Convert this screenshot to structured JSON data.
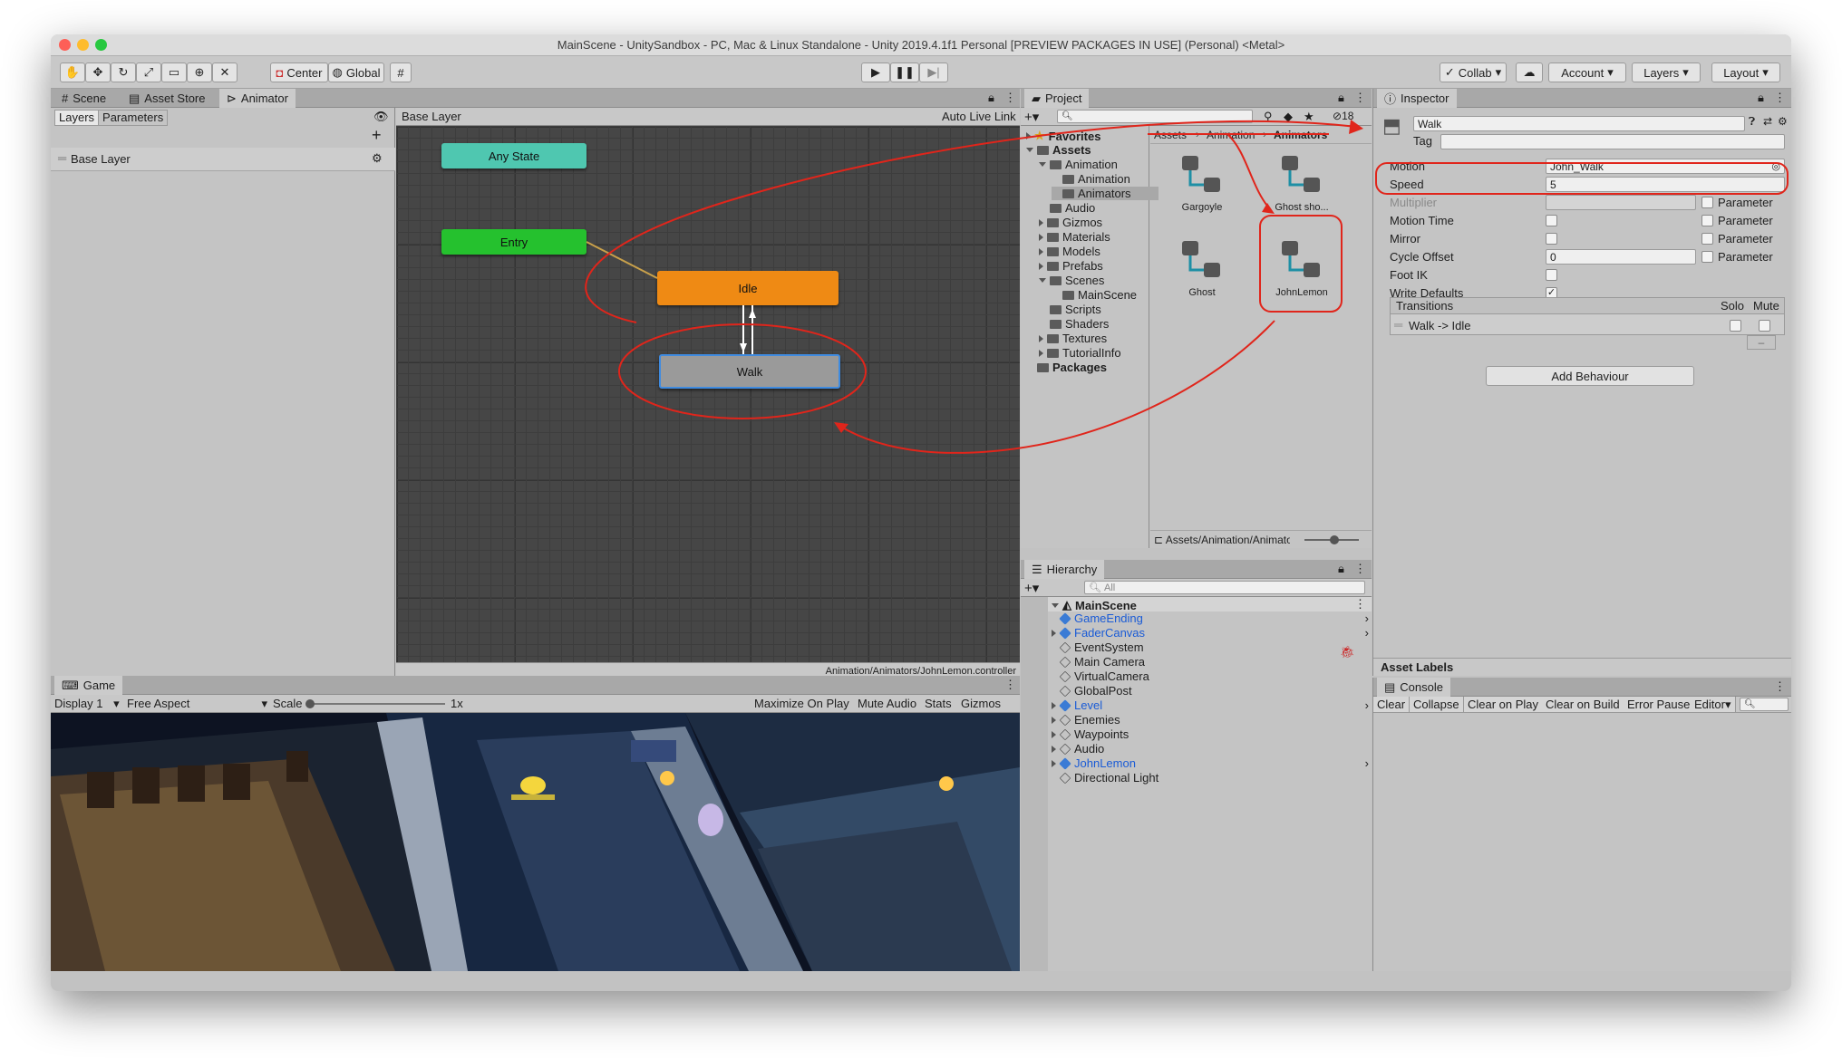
{
  "window": {
    "title": "MainScene - UnitySandbox - PC, Mac & Linux Standalone - Unity 2019.4.1f1 Personal [PREVIEW PACKAGES IN USE] (Personal) <Metal>"
  },
  "toolbar": {
    "center_label": "Center",
    "global_label": "Global",
    "collab_label": "Collab",
    "account_label": "Account",
    "layers_label": "Layers",
    "layout_label": "Layout"
  },
  "left_tabs": [
    "Scene",
    "Asset Store",
    "Animator"
  ],
  "animator": {
    "subtabs": [
      "Layers",
      "Parameters"
    ],
    "layer_name": "Base Layer",
    "breadcrumb": "Base Layer",
    "auto_live_link": "Auto Live Link",
    "footer_path": "Animation/Animators/JohnLemon.controller",
    "states": {
      "any_state": "Any State",
      "entry": "Entry",
      "idle": "Idle",
      "walk": "Walk"
    }
  },
  "game": {
    "tab": "Game",
    "display": "Display 1",
    "aspect": "Free Aspect",
    "scale_label": "Scale",
    "scale_value": "1x",
    "buttons": [
      "Maximize On Play",
      "Mute Audio",
      "Stats",
      "Gizmos"
    ]
  },
  "project": {
    "tab": "Project",
    "favorites": "Favorites",
    "tree": [
      {
        "label": "Assets",
        "depth": 0,
        "expanded": true,
        "bold": true
      },
      {
        "label": "Animation",
        "depth": 1,
        "expanded": true
      },
      {
        "label": "Animation",
        "depth": 2
      },
      {
        "label": "Animators",
        "depth": 2,
        "selected": true
      },
      {
        "label": "Audio",
        "depth": 1
      },
      {
        "label": "Gizmos",
        "depth": 1,
        "collapsed": true
      },
      {
        "label": "Materials",
        "depth": 1,
        "collapsed": true
      },
      {
        "label": "Models",
        "depth": 1,
        "collapsed": true
      },
      {
        "label": "Prefabs",
        "depth": 1,
        "collapsed": true
      },
      {
        "label": "Scenes",
        "depth": 1,
        "expanded": true
      },
      {
        "label": "MainScene",
        "depth": 2
      },
      {
        "label": "Scripts",
        "depth": 1
      },
      {
        "label": "Shaders",
        "depth": 1
      },
      {
        "label": "Textures",
        "depth": 1,
        "collapsed": true
      },
      {
        "label": "TutorialInfo",
        "depth": 1,
        "collapsed": true
      },
      {
        "label": "Packages",
        "depth": 0,
        "bold": true
      }
    ],
    "breadcrumb": [
      "Assets",
      "Animation",
      "Animators"
    ],
    "assets": [
      "Gargoyle",
      "Ghost sho...",
      "Ghost",
      "JohnLemon"
    ],
    "footer_path": "Assets/Animation/Animator",
    "hidden_count": "18"
  },
  "hierarchy": {
    "tab": "Hierarchy",
    "search_placeholder": "All",
    "scene": "MainScene",
    "items": [
      {
        "label": "GameEnding",
        "prefab": true
      },
      {
        "label": "FaderCanvas",
        "prefab": true,
        "collapsed": true
      },
      {
        "label": "EventSystem"
      },
      {
        "label": "Main Camera"
      },
      {
        "label": "VirtualCamera"
      },
      {
        "label": "GlobalPost"
      },
      {
        "label": "Level",
        "prefab": true,
        "collapsed": true
      },
      {
        "label": "Enemies",
        "collapsed": true
      },
      {
        "label": "Waypoints",
        "collapsed": true
      },
      {
        "label": "Audio",
        "collapsed": true
      },
      {
        "label": "JohnLemon",
        "prefab": true,
        "collapsed": true
      },
      {
        "label": "Directional Light"
      }
    ]
  },
  "inspector": {
    "tab": "Inspector",
    "name": "Walk",
    "tag_label": "Tag",
    "rows": [
      {
        "label": "Motion",
        "value": "John_Walk"
      },
      {
        "label": "Speed",
        "value": "5"
      },
      {
        "label": "Multiplier",
        "param": "Parameter"
      },
      {
        "label": "Motion Time",
        "param": "Parameter"
      },
      {
        "label": "Mirror",
        "param": "Parameter"
      },
      {
        "label": "Cycle Offset",
        "value": "0",
        "param": "Parameter"
      },
      {
        "label": "Foot IK"
      },
      {
        "label": "Write Defaults",
        "checked": true
      }
    ],
    "transitions_header": "Transitions",
    "solo_label": "Solo",
    "mute_label": "Mute",
    "transition": "Walk -> Idle",
    "add_behaviour": "Add Behaviour",
    "asset_labels": "Asset Labels"
  },
  "console": {
    "tab": "Console",
    "buttons": [
      "Clear",
      "Collapse",
      "Clear on Play",
      "Clear on Build",
      "Error Pause",
      "Editor"
    ]
  },
  "colors": {
    "annotation": "#e0251b",
    "idle_state": "#ef8a14",
    "entry_state": "#25c12e",
    "any_state": "#4fc7b0",
    "prefab_blue": "#1a5bd6"
  }
}
